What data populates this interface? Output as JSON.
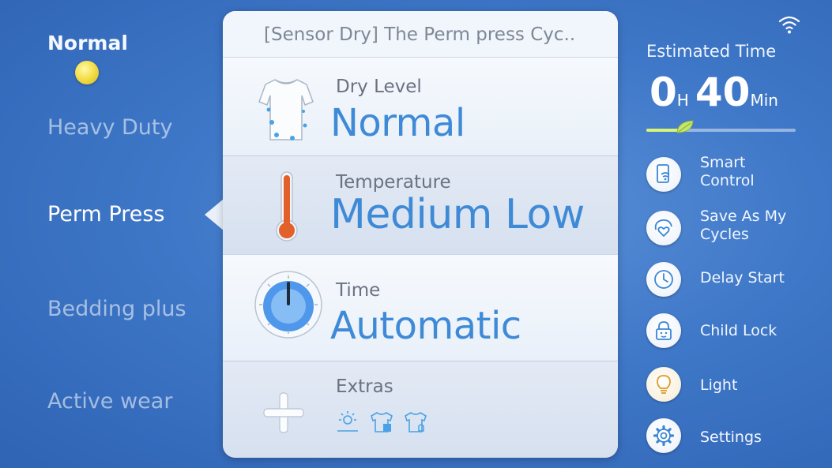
{
  "status": {
    "wifi_icon": "wifi-icon"
  },
  "cycles": [
    {
      "label": "Normal",
      "state": "current-cycle-indicator"
    },
    {
      "label": "Heavy Duty"
    },
    {
      "label": "Perm Press",
      "selected": true
    },
    {
      "label": "Bedding plus"
    },
    {
      "label": "Active wear"
    }
  ],
  "panel": {
    "title": "[Sensor Dry] The Perm press Cyc..",
    "dry_level": {
      "label": "Dry Level",
      "value": "Normal",
      "icon": "shirt-icon"
    },
    "temperature": {
      "label": "Temperature",
      "value": "Medium Low",
      "icon": "thermometer-icon"
    },
    "time": {
      "label": "Time",
      "value": "Automatic",
      "icon": "timer-dial-icon"
    },
    "extras": {
      "label": "Extras",
      "icons": [
        "wrinkle-prevent-icon",
        "shirt-dry-icon",
        "shirt-alarm-icon"
      ],
      "add_icon": "plus-icon"
    }
  },
  "estimate": {
    "label": "Estimated Time",
    "hours": "0",
    "hours_unit": "H",
    "minutes": "40",
    "minutes_unit": "Min",
    "progress": 0.22,
    "accent_color": "#d9f27a"
  },
  "actions": [
    {
      "label": "Smart Control",
      "icon": "smart-control-icon"
    },
    {
      "label": "Save As My Cycles",
      "icon": "save-heart-icon"
    },
    {
      "label": "Delay Start",
      "icon": "clock-icon"
    },
    {
      "label": "Child Lock",
      "icon": "lock-icon"
    },
    {
      "label": "Light",
      "icon": "bulb-icon"
    },
    {
      "label": "Settings",
      "icon": "gear-icon"
    }
  ],
  "colors": {
    "accent_blue": "#3f8ad6",
    "bg_blue": "#3f78c8",
    "thermo_orange": "#e2602a"
  }
}
